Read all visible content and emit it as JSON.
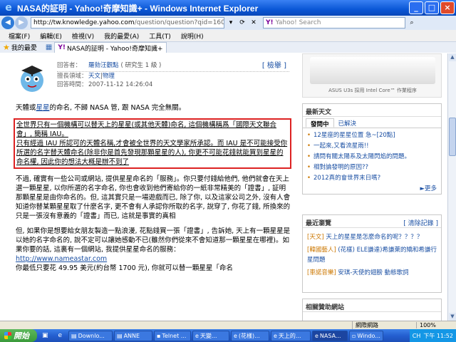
{
  "window": {
    "title": "NASA的証明 - Yahoo!奇摩知識+ - Windows Internet Explorer"
  },
  "addressbar": {
    "url_host": "http://tw.knowledge.yahoo.com",
    "url_rest": "/question/question?qid=16071110",
    "search_placeholder": "Yahoo! Search",
    "search_brand": "Y!"
  },
  "menu": [
    "檔案(F)",
    "編輯(E)",
    "檢視(V)",
    "我的最愛(A)",
    "工具(T)",
    "說明(H)"
  ],
  "favorites": {
    "label": "我的最愛",
    "tab_label": "NASA的証明 - Yahoo!奇摩知識+"
  },
  "answer": {
    "respondent_label": "回答者：",
    "respondent_name": "羅勃汪觀點",
    "respondent_level": "( 研究生 1 級 )",
    "report": "[ 檢舉 ]",
    "category_label": "擅長領域：",
    "category_1": "天文",
    "category_sep": " | ",
    "category_2": "物理",
    "time_label": "回答時間：",
    "time": "2007-11-12 14:26:04"
  },
  "body": {
    "p1_a": "天體或",
    "p1_link": "星星",
    "p1_b": "的命名, 不歸 NASA 管, 跟 NASA 完全無關。",
    "hl_1": "全世界只有一個機構可以替天上的星星(或其他天體)命名, 這個機構稱爲「國際天文聯合會」, 簡稱 IAU。",
    "hl_2": "只有經過 IAU 所認可的天體名稱,才會被全世界的天文學家所承認。而 IAU 是不可能接受你所選的名字替天體命名(除非你是首先發現那顆星星的人), 你更不可能花錢就能買到星星的命名權, 因此你的想法大概是辦不到了",
    "p3": "不過, 確實有一些公司或網站, 提供星星命名的「服務」。你只要付錢給他們, 他們就會在天上選一顆星星, 以你所選的名字命名, 你也會收到他們寄給你的一紙非常精美的「證書」, 証明那顆星星是由你命名的。但, 這其實只是一場遊戲而已, 除了你, 以及這家公司之外, 沒有人會知道你替某顆星星取了什麼名字, 更不會有人承認你所取的名字, 說穿了, 你花了錢, 所換來的只是一張沒有意義的「證書」而已, 這就是事實的真相",
    "p4": "但, 如果你是想要給女朋友製造一點浪漫, 花點錢買一張「證書」, 告訴她, 天上有一顆星星是以她的名字命名的, 說不定可以讓她感動不已(雖然你們從來不會知道那一顆星星在哪裡)。如果你要的話, 這裏有一個網站, 我提供星星命名的服務：",
    "link": "http://www.nameastar.com",
    "p5": "你最低只要花 49.95 美元(約台幣 1700 元), 你就可以替一顆星星「命名"
  },
  "ad": {
    "text": "ASUS U3s 採用 Intel Core™ 作業程序"
  },
  "latest": {
    "title": "最新天文",
    "tab_on": "發問中",
    "tab_off": "已解決",
    "items": [
      "12星座的星星位置 急~[20點]",
      "一起來,又看流星雨!!",
      "請問有關太陽系及太陽閃焰的問題。",
      "相對論發明的原因??",
      "2012真的會世界末日嗎?"
    ],
    "more": "►更多"
  },
  "recent": {
    "title": "最近瀏覽",
    "clear": "[ 清除記錄 ]",
    "items": [
      {
        "cat": "[天文]",
        "text": "天上的星星是怎麼命名的呢？？？？"
      },
      {
        "cat": "[韓國藝人]",
        "text": "(花樣) ELE謙達)希謙萊的矯和希謙行星問題"
      },
      {
        "cat": "[車諾音樂]",
        "text": "安琪-天使的翅膀 動態歌詞"
      }
    ]
  },
  "sponsor": {
    "title": "相關贊助網站"
  },
  "status": {
    "left": "",
    "zone": "網際網路",
    "zoom": "100%"
  },
  "taskbar": {
    "start": "開始",
    "tasks": [
      "Downlo...",
      "ANNE",
      "Telnet ...",
      "天變...",
      "(花樣)...",
      "天上的...",
      "NASA...",
      "Windo..."
    ],
    "lang": "CH",
    "clock": "下午 11:52"
  }
}
